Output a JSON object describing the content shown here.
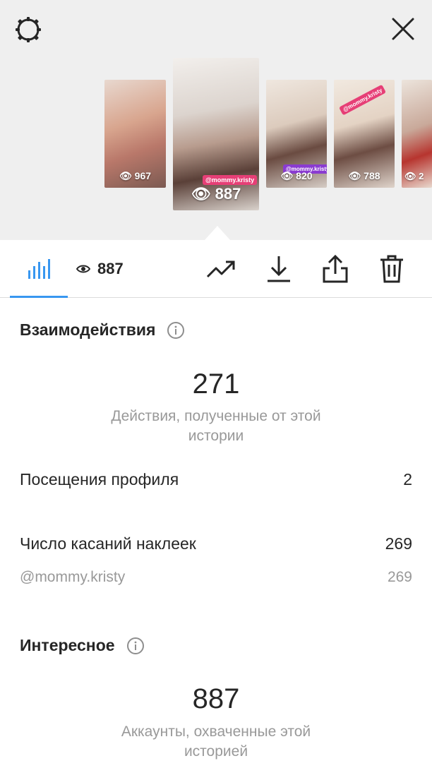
{
  "header": {
    "settings_icon": "gear-icon",
    "close_icon": "close-icon"
  },
  "stories": [
    {
      "views": "967"
    },
    {
      "views": "887",
      "tag": "@mommy.kristy"
    },
    {
      "views": "820",
      "tag": "@mommy.kristy"
    },
    {
      "views": "788",
      "tag": "@mommy.kristy"
    },
    {
      "views": "2"
    }
  ],
  "toolbar": {
    "viewers_count": "887",
    "icons": [
      "insights-bar-icon",
      "eye-icon",
      "trending-icon",
      "download-icon",
      "share-icon",
      "trash-icon"
    ],
    "accent_color": "#3897f0"
  },
  "interactions": {
    "title": "Взаимодействия",
    "total": "271",
    "caption": "Действия, полученные от этой истории",
    "profile_visits_label": "Посещения профиля",
    "profile_visits_value": "2",
    "sticker_taps_label": "Число касаний наклеек",
    "sticker_taps_value": "269",
    "sticker_name": "@mommy.kristy",
    "sticker_value": "269"
  },
  "discovery": {
    "title": "Интересное",
    "total": "887",
    "caption": "Аккаунты, охваченные этой историей"
  }
}
